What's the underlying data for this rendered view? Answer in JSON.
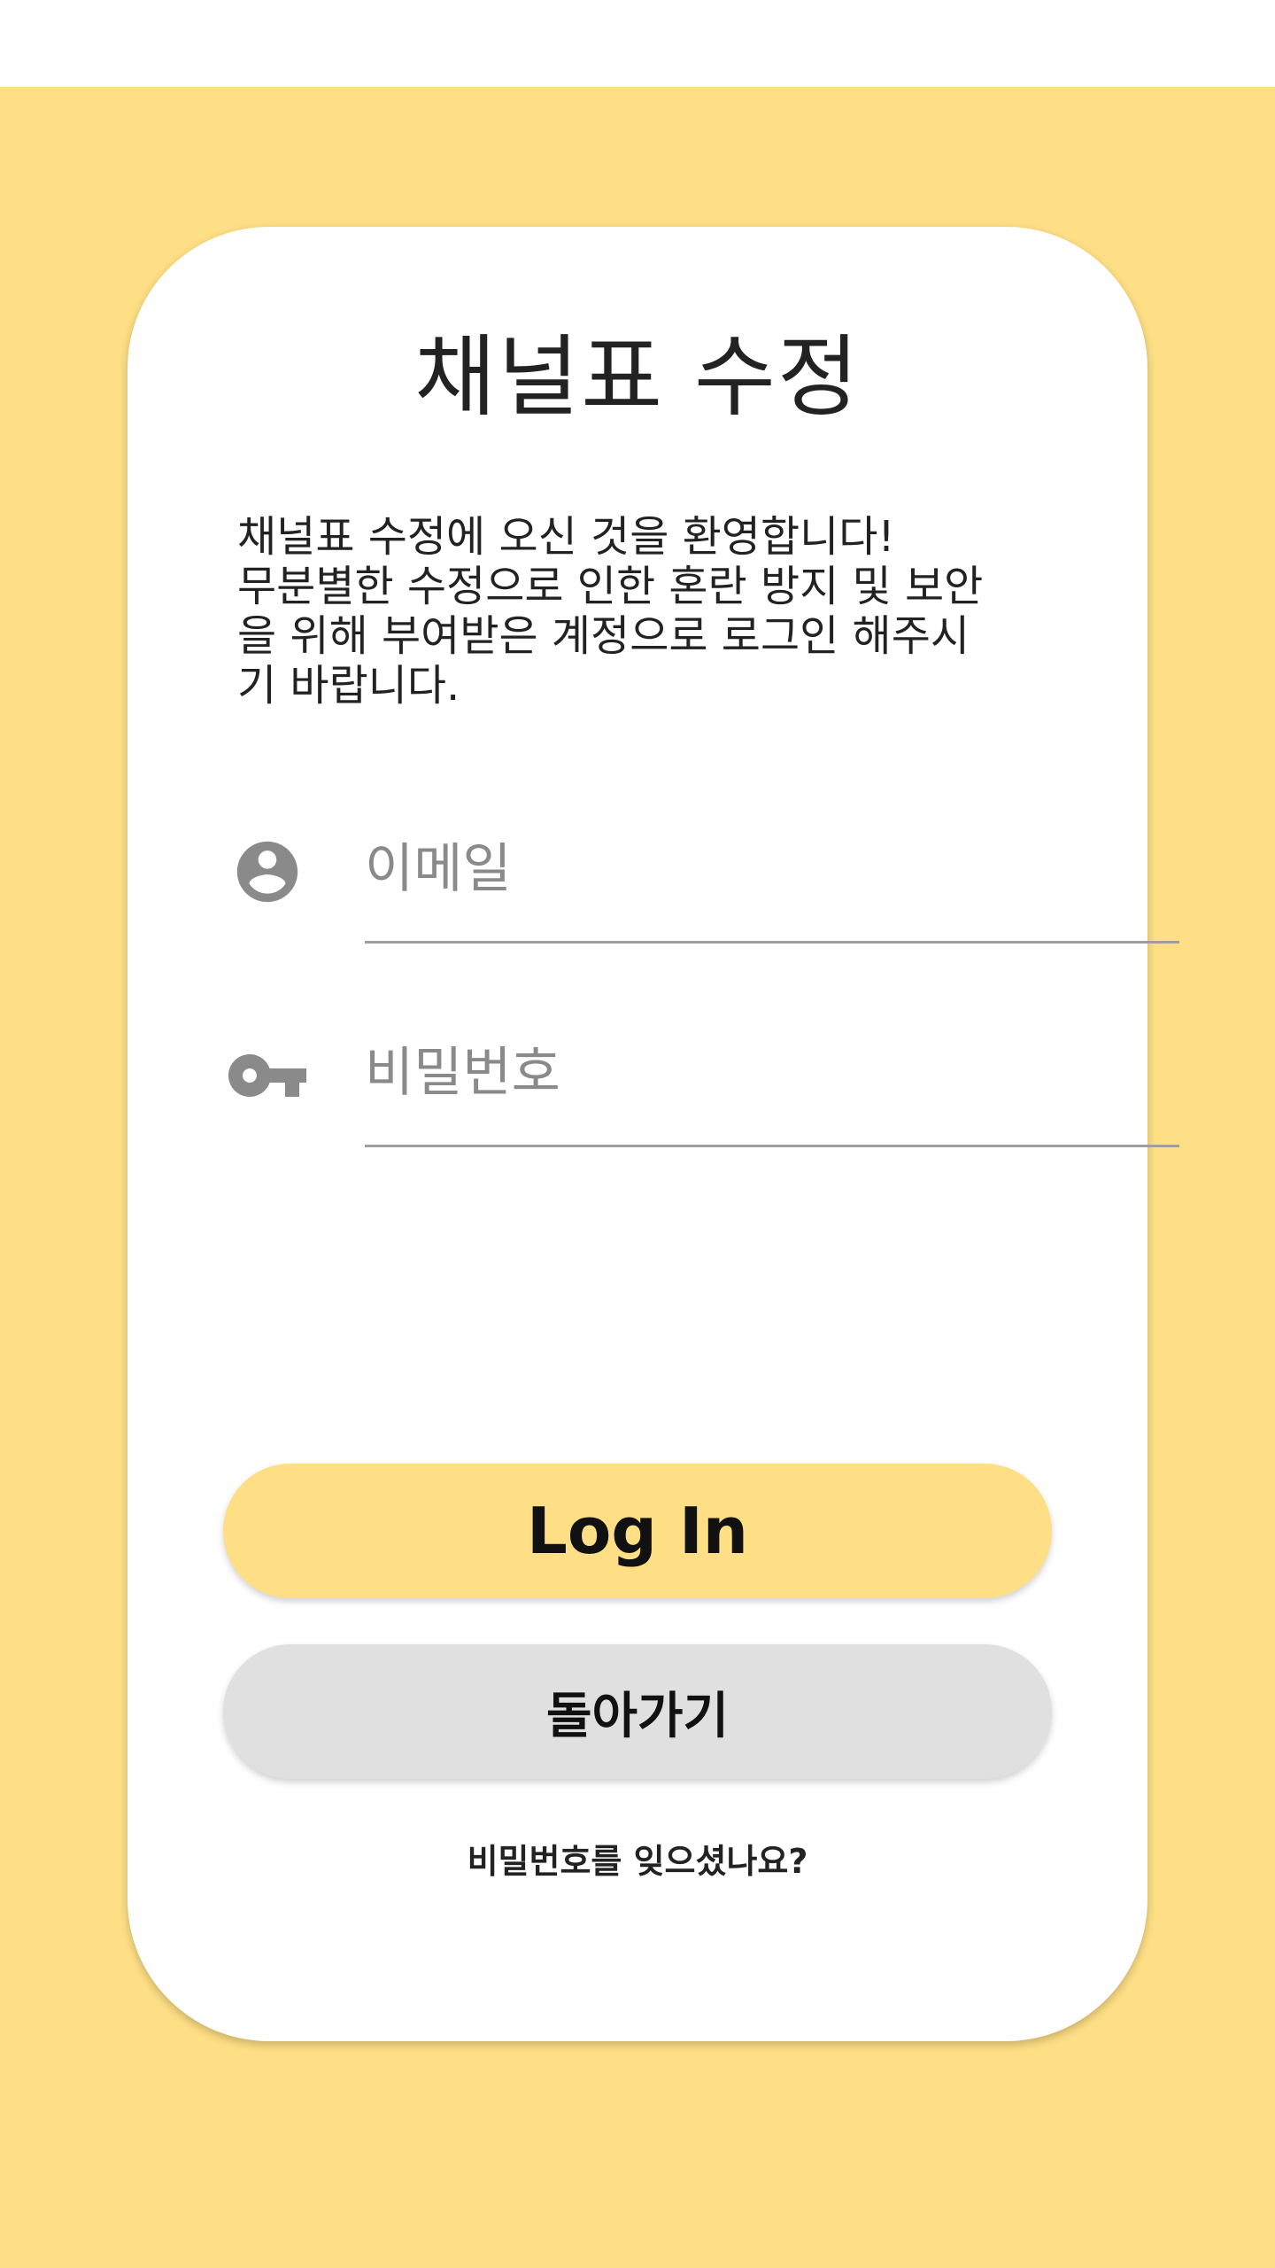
{
  "login_card": {
    "title": "채널표 수정",
    "welcome_message": "채널표 수정에 오신 것을 환영합니다!\n무분별한 수정으로 인한 혼란 방지 및 보안\n을 위해 부여받은 계정으로 로그인 해주시\n기 바랍니다.",
    "email": {
      "icon": "account-circle-icon",
      "placeholder": "이메일",
      "value": ""
    },
    "password": {
      "icon": "key-icon",
      "placeholder": "비밀번호",
      "value": ""
    },
    "login_button_label": "Log In",
    "back_button_label": "돌아가기",
    "forgot_password_link": "비밀번호를 잊으셨나요?"
  },
  "colors": {
    "background": "#fedf85",
    "card": "#ffffff",
    "login_button": "#fedf85",
    "back_button": "#e0e0e0",
    "icon": "#8a8a8a",
    "underline": "#9e9e9e"
  }
}
